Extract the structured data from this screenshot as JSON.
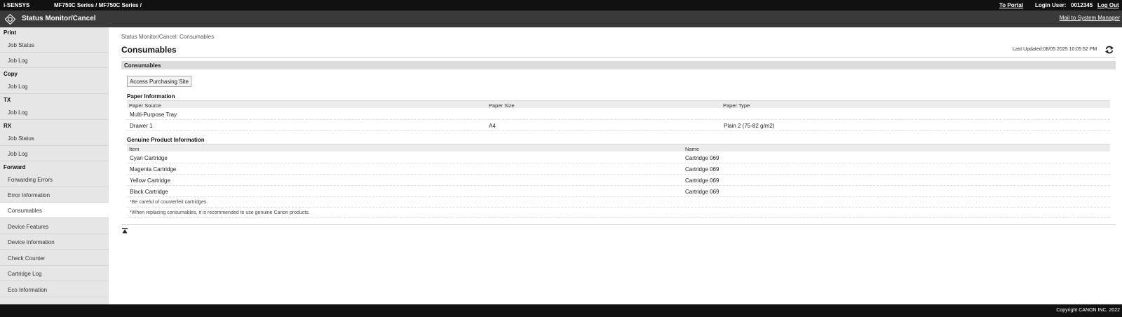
{
  "topbar": {
    "brand": "i-SENSYS",
    "model": "MF750C Series / MF750C Series /",
    "to_portal": "To Portal",
    "login_user_label": "Login User:",
    "login_user_value": "0012345",
    "logout": "Log Out"
  },
  "titlebar": {
    "title": "Status Monitor/Cancel",
    "mail": "Mail to System Manager"
  },
  "sidebar": {
    "print": "Print",
    "print_job_status": "Job Status",
    "print_job_log": "Job Log",
    "copy": "Copy",
    "copy_job_log": "Job Log",
    "tx": "TX",
    "tx_job_log": "Job Log",
    "rx": "RX",
    "rx_job_status": "Job Status",
    "rx_job_log": "Job Log",
    "forward": "Forward",
    "forwarding_errors": "Forwarding Errors",
    "error_information": "Error Information",
    "consumables": "Consumables",
    "device_features": "Device Features",
    "device_information": "Device Information",
    "check_counter": "Check Counter",
    "cartridge_log": "Cartridge Log",
    "eco_information": "Eco Information"
  },
  "main": {
    "breadcrumb": "Status Monitor/Cancel: Consumables",
    "title": "Consumables",
    "last_updated": "Last Updated:08/05 2025 10:05:52 PM",
    "section_title": "Consumables",
    "purchase_button": "Access Purchasing Site",
    "paper_heading": "Paper Information",
    "paper_cols": [
      "Paper Source",
      "Paper Size",
      "Paper Type"
    ],
    "paper_rows": [
      [
        "Multi-Purpose Tray",
        "",
        ""
      ],
      [
        "Drawer 1",
        "A4",
        "Plain 2 (75-82 g/m2)"
      ]
    ],
    "genuine_heading": "Genuine Product Information",
    "genuine_cols": [
      "Item",
      "Name"
    ],
    "genuine_rows": [
      [
        "Cyan Cartridge",
        "Cartridge 069"
      ],
      [
        "Magenta Cartridge",
        "Cartridge 069"
      ],
      [
        "Yellow Cartridge",
        "Cartridge 069"
      ],
      [
        "Black Cartridge",
        "Cartridge 069"
      ]
    ],
    "note_1": "*Be careful of counterfeit cartridges.",
    "note_2": "*When replacing consumables, it is recommended to use genuine Canon products."
  },
  "footer": {
    "copyright": "Copyright CANON INC. 2022"
  },
  "icons": {
    "logo": "canon-diamond-logo-icon",
    "refresh": "refresh-icon",
    "back_to_top": "back-to-top-icon"
  }
}
